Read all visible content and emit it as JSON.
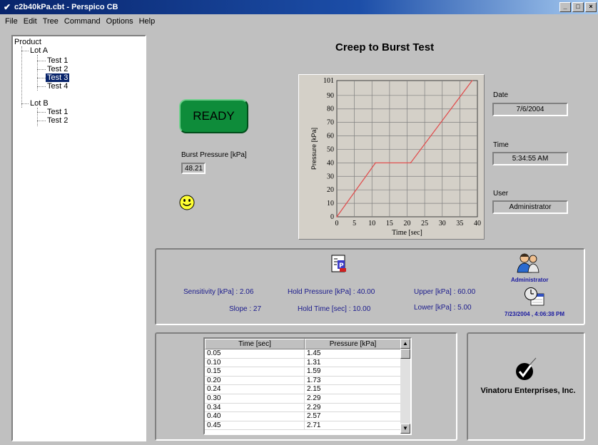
{
  "window": {
    "title": "c2b40kPa.cbt - Perspico CB",
    "minimize": "_",
    "maximize": "□",
    "close": "×"
  },
  "menu": [
    "File",
    "Edit",
    "Tree",
    "Command",
    "Options",
    "Help"
  ],
  "tree": {
    "root": "Product",
    "lotA": "Lot A",
    "lotA_tests": [
      "Test 1",
      "Test 2",
      "Test 3",
      "Test 4"
    ],
    "lotB": "Lot B",
    "lotB_tests": [
      "Test 1",
      "Test 2"
    ],
    "selected": "Test 3"
  },
  "main_title": "Creep to Burst Test",
  "status_button": "READY",
  "burst_pressure": {
    "label": "Burst Pressure [kPa]",
    "value": "48.21"
  },
  "date": {
    "label": "Date",
    "value": "7/6/2004"
  },
  "time": {
    "label": "Time",
    "value": "5:34:55 AM"
  },
  "user": {
    "label": "User",
    "value": "Administrator"
  },
  "stats": {
    "sensitivity": "Sensitivity [kPa] : 2.06",
    "slope": "Slope : 27",
    "hold_pressure": "Hold Pressure [kPa] : 40.00",
    "hold_time": "Hold Time [sec] : 10.00",
    "upper": "Upper [kPa] : 60.00",
    "lower": "Lower [kPa] :  5.00"
  },
  "admin_label": "Administrator",
  "datetime_stamp": "7/23/2004 , 4:06:38 PM",
  "company": "Vinatoru Enterprises, Inc.",
  "table": {
    "headers": [
      "Time [sec]",
      "Pressure [kPa]"
    ],
    "rows": [
      [
        "0.05",
        "1.45"
      ],
      [
        "0.10",
        "1.31"
      ],
      [
        "0.15",
        "1.59"
      ],
      [
        "0.20",
        "1.73"
      ],
      [
        "0.24",
        "2.15"
      ],
      [
        "0.30",
        "2.29"
      ],
      [
        "0.34",
        "2.29"
      ],
      [
        "0.40",
        "2.57"
      ],
      [
        "0.45",
        "2.71"
      ]
    ]
  },
  "colors": {
    "line": "#e05050",
    "ready": "#0e8c3a",
    "titlebar": "#08246b",
    "stat_text": "#1a1a8c"
  },
  "chart_data": {
    "type": "line",
    "xlabel": "Time  [sec]",
    "ylabel": "Pressure [kPa]",
    "xlim": [
      0,
      40
    ],
    "ylim": [
      0,
      101
    ],
    "xticks": [
      "0",
      "5",
      "10",
      "15",
      "20",
      "25",
      "30",
      "35",
      "40"
    ],
    "yticks": [
      "0",
      "10",
      "20",
      "30",
      "40",
      "50",
      "60",
      "70",
      "80",
      "90",
      "101"
    ],
    "grid": true,
    "series": [
      {
        "x": [
          0,
          11,
          21,
          38.5
        ],
        "y": [
          0,
          40,
          40,
          101
        ]
      }
    ]
  }
}
